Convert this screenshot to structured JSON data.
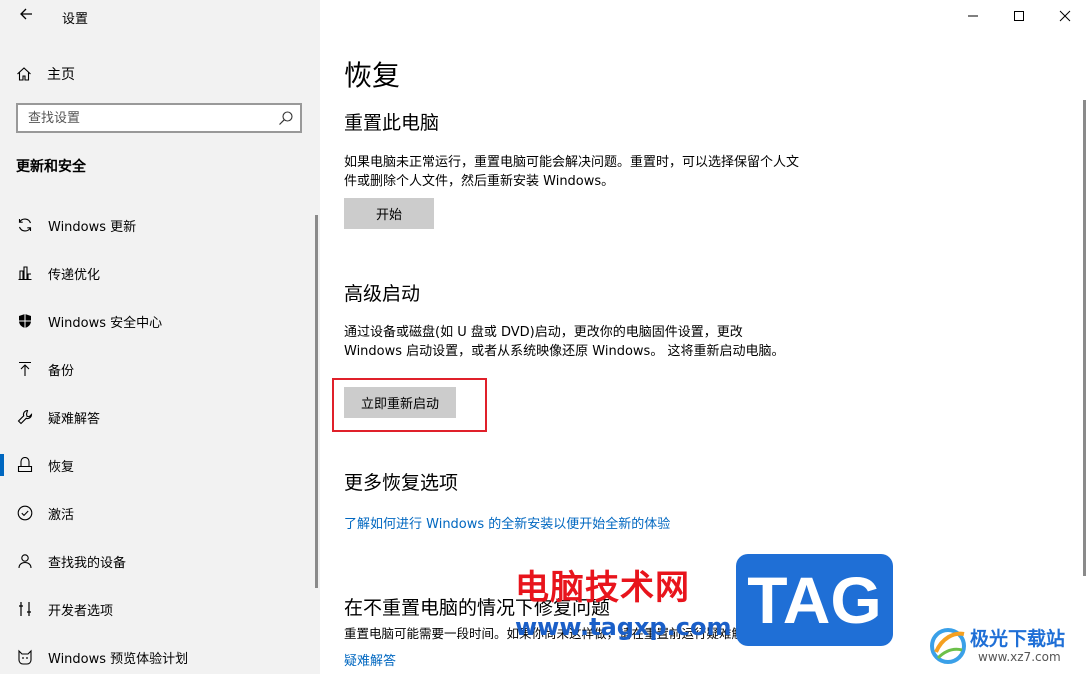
{
  "window": {
    "title": "设置",
    "controls": [
      "minimize-icon",
      "maximize-icon",
      "close-icon"
    ]
  },
  "sidebar": {
    "home_label": "主页",
    "search_placeholder": "查找设置",
    "section_title": "更新和安全",
    "items": [
      {
        "label": "Windows 更新",
        "icon": "refresh-icon"
      },
      {
        "label": "传递优化",
        "icon": "delivery-optimization-icon"
      },
      {
        "label": "Windows 安全中心",
        "icon": "shield-icon"
      },
      {
        "label": "备份",
        "icon": "backup-arrow-icon"
      },
      {
        "label": "疑难解答",
        "icon": "wrench-icon"
      },
      {
        "label": "恢复",
        "icon": "recovery-icon",
        "active": true
      },
      {
        "label": "激活",
        "icon": "check-circle-icon"
      },
      {
        "label": "查找我的设备",
        "icon": "find-device-icon"
      },
      {
        "label": "开发者选项",
        "icon": "developer-icon"
      },
      {
        "label": "Windows 预览体验计划",
        "icon": "insider-cat-icon"
      }
    ]
  },
  "main": {
    "title": "恢复",
    "reset": {
      "heading": "重置此电脑",
      "desc": "如果电脑未正常运行，重置电脑可能会解决问题。重置时，可以选择保留个人文件或删除个人文件，然后重新安装 Windows。",
      "button": "开始"
    },
    "advanced": {
      "heading": "高级启动",
      "desc": "通过设备或磁盘(如 U 盘或 DVD)启动，更改你的电脑固件设置，更改 Windows 启动设置，或者从系统映像还原 Windows。 这将重新启动电脑。",
      "button": "立即重新启动"
    },
    "more": {
      "heading": "更多恢复选项",
      "link": "了解如何进行 Windows 的全新安装以便开始全新的体验"
    },
    "fix": {
      "heading": "在不重置电脑的情况下修复问题",
      "desc": "重置电脑可能需要一段时间。如果你尚未这样做，请在重置前运行疑难解答来解决问题。",
      "link": "疑难解答"
    }
  },
  "watermark": {
    "text": "电脑技术网",
    "url": "www.tagxp.com",
    "tag": "TAG",
    "site_name": "极光下载站",
    "site_url": "www.xz7.com"
  },
  "colors": {
    "accent": "#0067c0",
    "highlight_box": "#e0202a",
    "sidebar_bg": "#f2f2f2",
    "button_bg": "#cccccc"
  }
}
